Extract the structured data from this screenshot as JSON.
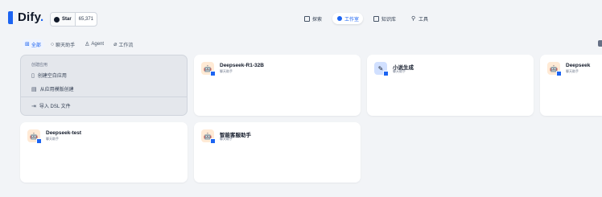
{
  "header": {
    "logo_text": "Dify",
    "logo_dot": ".",
    "github": {
      "star_label": "Star",
      "count": "65,371"
    },
    "nav": [
      {
        "label": "探索",
        "icon": "explore-icon",
        "active": false
      },
      {
        "label": "工作室",
        "icon": "studio-icon",
        "active": true
      },
      {
        "label": "知识库",
        "icon": "knowledge-icon",
        "active": false
      },
      {
        "label": "工具",
        "icon": "tools-icon",
        "active": false
      }
    ]
  },
  "filters": [
    {
      "label": "全部",
      "icon": "grid-icon",
      "active": true
    },
    {
      "label": "聊天助手",
      "icon": "chat-icon",
      "active": false
    },
    {
      "label": "Agent",
      "icon": "agent-icon",
      "active": false
    },
    {
      "label": "工作流",
      "icon": "workflow-icon",
      "active": false
    }
  ],
  "create": {
    "title": "创建应用",
    "items": [
      {
        "label": "创建空白应用",
        "icon": "file-icon"
      },
      {
        "label": "从应用模版创建",
        "icon": "template-icon"
      },
      {
        "label": "导入 DSL 文件",
        "icon": "import-icon"
      }
    ]
  },
  "apps": [
    {
      "name": "Deepseek-R1-32B",
      "type": "聊天助手",
      "avatar": "robot-icon"
    },
    {
      "name": "小说生成",
      "type": "聊天助手",
      "avatar": "pen-icon"
    },
    {
      "name": "Deepseek",
      "type": "聊天助手",
      "avatar": "robot-icon"
    },
    {
      "name": "Deepseek-test",
      "type": "聊天助手",
      "avatar": "robot-icon"
    },
    {
      "name": "智能客服助手",
      "type": "聊天助手",
      "avatar": "robot-icon"
    }
  ]
}
